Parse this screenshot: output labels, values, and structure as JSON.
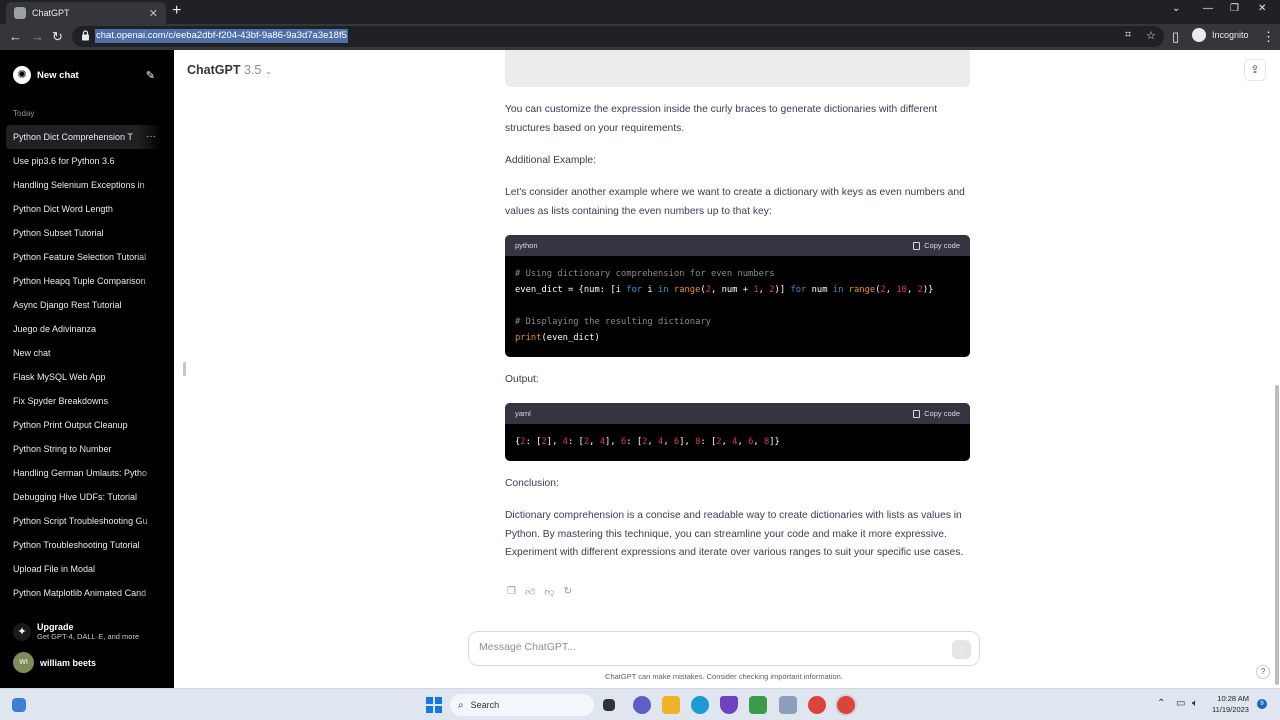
{
  "browser": {
    "tab_title": "ChatGPT",
    "url": "chat.openai.com/c/eeba2dbf-f204-43bf-9a86-9a3d7a3e18f5",
    "profile_label": "Incognito"
  },
  "sidebar": {
    "new_chat_label": "New chat",
    "section_label": "Today",
    "items": [
      "Python Dict Comprehension T",
      "Use pip3.6 for Python 3.6",
      "Handling Selenium Exceptions in",
      "Python Dict Word Length",
      "Python Subset Tutorial",
      "Python Feature Selection Tutorial",
      "Python Heapq Tuple Comparison",
      "Async Django Rest Tutorial",
      "Juego de Adivinanza",
      "New chat",
      "Flask MySQL Web App",
      "Fix Spyder Breakdowns",
      "Python Print Output Cleanup",
      "Python String to Number",
      "Handling German Umlauts: Pytho",
      "Debugging Hive UDFs: Tutorial",
      "Python Script Troubleshooting Gu",
      "Python Troubleshooting Tutorial",
      "Upload File in Modal",
      "Python Matplotlib Animated Cand"
    ],
    "upgrade": {
      "title": "Upgrade",
      "subtitle": "Get GPT-4, DALL·E, and more"
    },
    "user": {
      "initials": "WI",
      "name": "william beets"
    }
  },
  "header": {
    "model_name": "ChatGPT",
    "model_version": "3.5"
  },
  "message": {
    "para1": "You can customize the expression inside the curly braces to generate dictionaries with different structures based on your requirements.",
    "para2": "Additional Example:",
    "para3": "Let's consider another example where we want to create a dictionary with keys as even numbers and values as lists containing the even numbers up to that key:",
    "code1": {
      "lang": "python",
      "copy_label": "Copy code",
      "line1": "# Using dictionary comprehension for even numbers",
      "line3": "# Displaying the resulting dictionary"
    },
    "output_label": "Output:",
    "code2": {
      "lang": "yaml",
      "copy_label": "Copy code"
    },
    "conclusion_label": "Conclusion:",
    "conclusion": "Dictionary comprehension is a concise and readable way to create dictionaries with lists as values in Python. By mastering this technique, you can streamline your code and make it more expressive. Experiment with different expressions and iterate over various ranges to suit your specific use cases."
  },
  "composer": {
    "placeholder": "Message ChatGPT..."
  },
  "disclaimer": "ChatGPT can make mistakes. Consider checking important information.",
  "taskbar": {
    "search_label": "Search",
    "time": "10:28 AM",
    "date": "11/19/2023",
    "notification_count": "9"
  }
}
